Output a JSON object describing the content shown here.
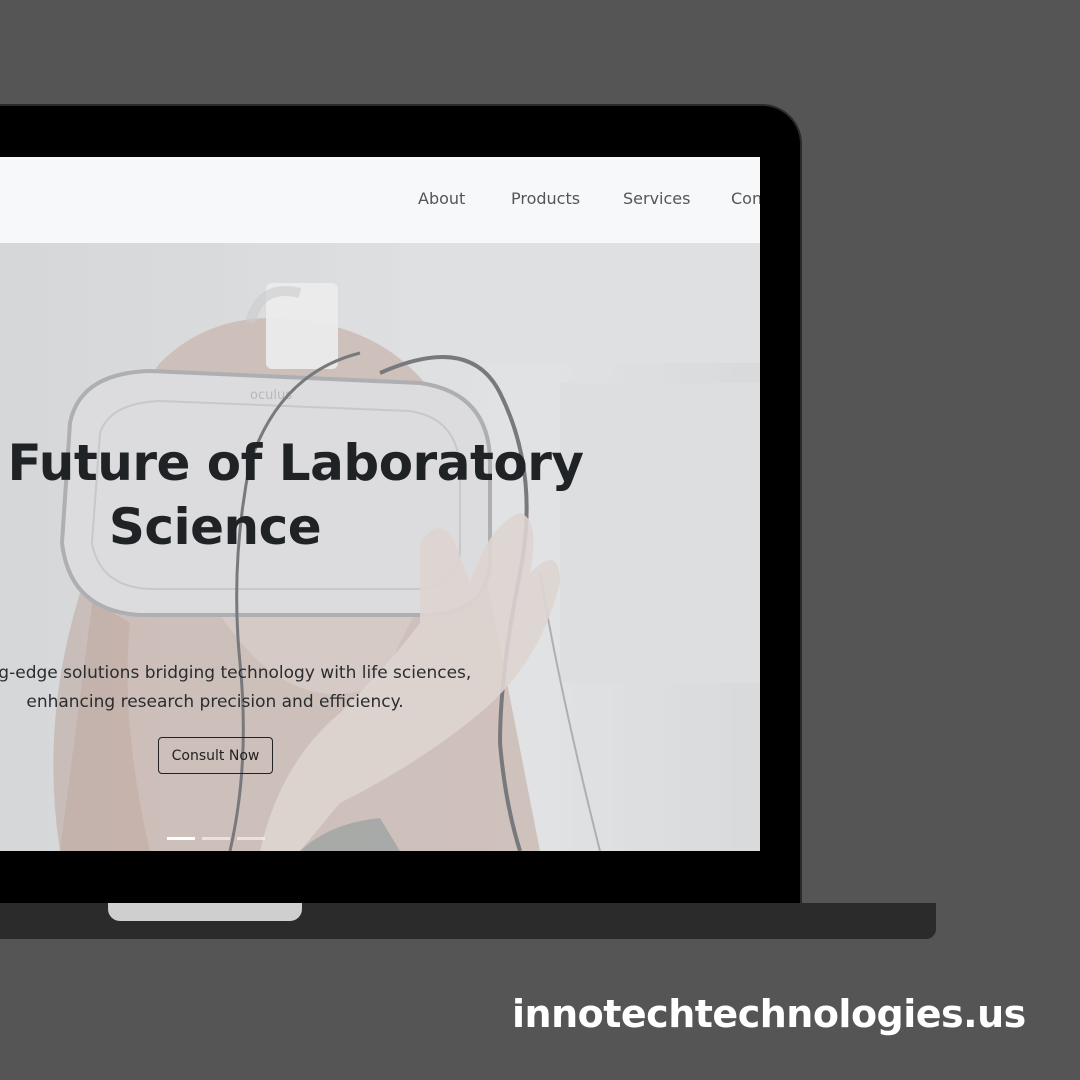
{
  "nav": {
    "items": [
      {
        "label": "About"
      },
      {
        "label": "Products"
      },
      {
        "label": "Services"
      },
      {
        "label": "Con"
      }
    ]
  },
  "hero": {
    "title_line1": "g the Future of Laboratory",
    "title_line2": "Science",
    "subtitle_line1": "utting-edge solutions bridging technology with life sciences,",
    "subtitle_line2": "enhancing research precision and efficiency.",
    "cta_label": "Consult Now",
    "headset_brand": "oculus",
    "carousel": {
      "slides": 3,
      "active": 1
    }
  },
  "footer": {
    "url": "innotechtechnologies.us"
  },
  "colors": {
    "background": "#555555",
    "navbar": "#f7f8fa",
    "title": "#1f2326"
  }
}
